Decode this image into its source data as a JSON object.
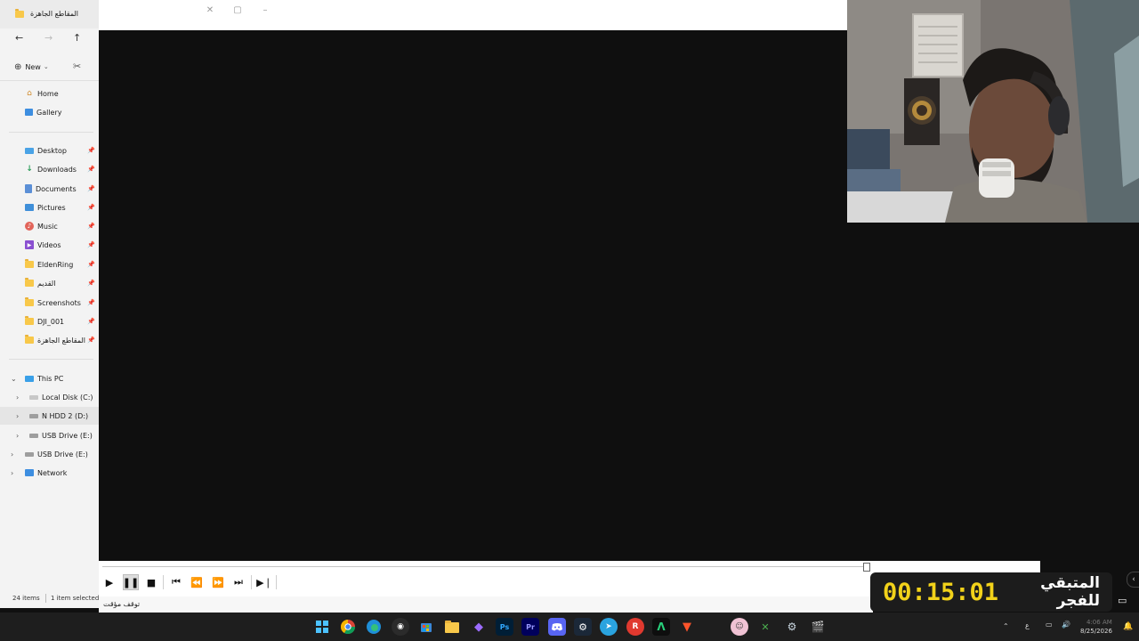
{
  "explorer": {
    "title": "المقاطع الجاهزة",
    "new_label": "New",
    "new_chevron": "⌄",
    "quick": [
      {
        "label": "Home",
        "icon": "home-icon"
      },
      {
        "label": "Gallery",
        "icon": "gallery-icon"
      }
    ],
    "pinned": [
      {
        "label": "Desktop",
        "icon": "desktop-icon"
      },
      {
        "label": "Downloads",
        "icon": "downloads-icon"
      },
      {
        "label": "Documents",
        "icon": "documents-icon"
      },
      {
        "label": "Pictures",
        "icon": "pictures-icon"
      },
      {
        "label": "Music",
        "icon": "music-icon"
      },
      {
        "label": "Videos",
        "icon": "videos-icon"
      },
      {
        "label": "EldenRing",
        "icon": "folder-icon"
      },
      {
        "label": "القديم",
        "icon": "folder-icon"
      },
      {
        "label": "Screenshots",
        "icon": "folder-icon"
      },
      {
        "label": "DJI_001",
        "icon": "folder-icon"
      },
      {
        "label": "المقاطع الجاهزة",
        "icon": "folder-icon"
      }
    ],
    "tree": {
      "this_pc": "This PC",
      "drives": [
        "Local Disk (C:)",
        "N HDD 2 (D:)",
        "USB Drive (E:)"
      ],
      "usb_root": "USB Drive (E:)",
      "network": "Network"
    },
    "status": {
      "items": "24 items",
      "selected": "1 item selected"
    }
  },
  "player": {
    "status_text": "توقف مؤقت"
  },
  "overlay": {
    "countdown": "00:15:01",
    "label": "المتبقي للفجر"
  },
  "taskbar": {
    "date": "8/25/2026",
    "time": "4:06 AM"
  },
  "colors": {
    "countdown": "#f2d21a",
    "video_bg": "#0f0f0f",
    "sidebar_bg": "#f3f3f3"
  }
}
